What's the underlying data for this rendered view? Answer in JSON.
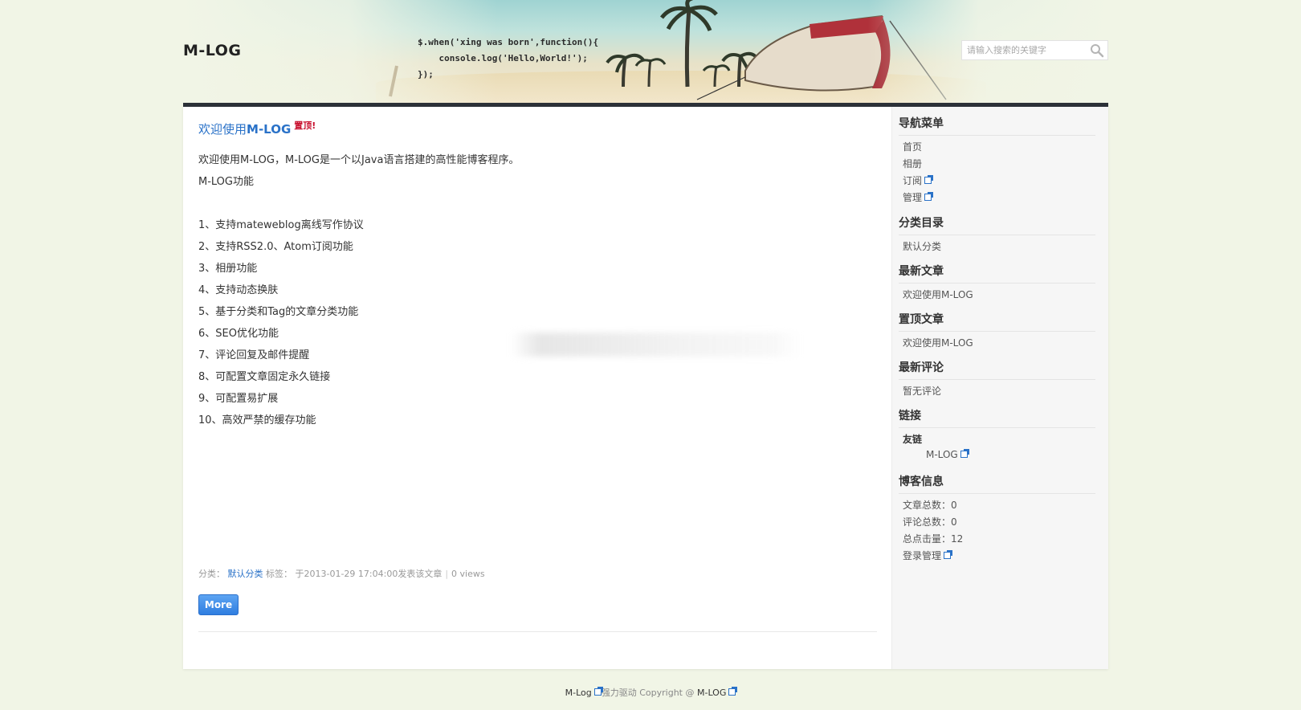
{
  "header": {
    "logo": "M-LOG",
    "code_line_1": "$.when('xing was born',function(){",
    "code_line_2": "    console.log('Hello,World!');",
    "code_line_3": "});",
    "search": {
      "placeholder": "请输入搜索的关键字",
      "value": ""
    }
  },
  "post": {
    "title_prefix": "欢迎使用",
    "title_main": "M-LOG",
    "top_badge": "置顶!",
    "lines": [
      "欢迎使用M-LOG，M-LOG是一个以Java语言搭建的高性能博客程序。",
      "M-LOG功能",
      "",
      "1、支持mateweblog离线写作协议",
      "2、支持RSS2.0、Atom订阅功能",
      "3、相册功能",
      "4、支持动态换肤",
      "5、基于分类和Tag的文章分类功能",
      "6、SEO优化功能",
      "7、评论回复及邮件提醒",
      "8、可配置文章固定永久链接",
      "9、可配置易扩展",
      "10、高效严禁的缓存功能"
    ],
    "meta": {
      "category_label": "分类：",
      "category_value": "默认分类",
      "tag_label": "标签：",
      "date_text": "于2013-01-29 17:04:00发表该文章",
      "views_text": "0 views"
    },
    "more_label": "More"
  },
  "sidebar": {
    "nav": {
      "title": "导航菜单",
      "items": [
        "首页",
        "相册",
        "订阅",
        "管理"
      ]
    },
    "categories": {
      "title": "分类目录",
      "items": [
        "默认分类"
      ]
    },
    "latest_posts": {
      "title": "最新文章",
      "items": [
        "欢迎使用M-LOG"
      ]
    },
    "top_posts": {
      "title": "置顶文章",
      "items": [
        "欢迎使用M-LOG"
      ]
    },
    "latest_comments": {
      "title": "最新评论",
      "items": [
        "暂无评论"
      ]
    },
    "links": {
      "title": "链接",
      "group": "友链",
      "items": [
        "M-LOG"
      ]
    },
    "blog_info": {
      "title": "博客信息",
      "post_count_label": "文章总数：",
      "post_count": "0",
      "comment_count_label": "评论总数：",
      "comment_count": "0",
      "hits_label": "总点击量：",
      "hits": "12",
      "login_label": "登录管理"
    }
  },
  "footer": {
    "brand": "M-Log",
    "powered": "强力驱动 Copyright @ ",
    "site": "M-LOG"
  },
  "colors": {
    "accent": "#2a72c8",
    "badge": "#c8102e",
    "topbar": "#2c3138",
    "page_bg": "#f1f5e6"
  }
}
